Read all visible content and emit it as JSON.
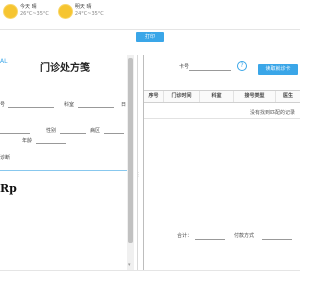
{
  "weather": [
    {
      "day": "今天",
      "cond": "晴",
      "temp": "26°C~35°C",
      "icon": "sun-icon"
    },
    {
      "day": "明天",
      "cond": "晴",
      "temp": "24°C~35°C",
      "icon": "sun-icon"
    }
  ],
  "toolbar": {
    "print_label": "打印"
  },
  "prescription": {
    "left_mark": "AL",
    "title": "门诊处方笺",
    "labels": {
      "id_suffix": "号",
      "department": "科室",
      "date_initial": "日",
      "gender": "性别",
      "ward": "病区",
      "age": "年龄",
      "diagnosis": "诊断",
      "rp": "Rp"
    }
  },
  "right_panel": {
    "card_label": "卡号",
    "help_symbol": "?",
    "read_card_label": "读取就诊卡",
    "table": {
      "columns": [
        "序号",
        "门诊时间",
        "科室",
        "接号类型",
        "医生"
      ],
      "empty_text": "没有找到匹配的记录"
    },
    "total_label": "合计：",
    "payment_label": "付款方式"
  },
  "colors": {
    "accent": "#3aa6e8",
    "sun": "#f6c531"
  }
}
